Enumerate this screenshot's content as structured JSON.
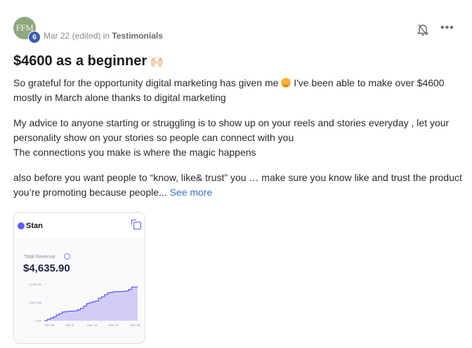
{
  "post": {
    "author_initials": "FFM",
    "level": "6",
    "date": "Mar 22 (edited)",
    "in_word": "in",
    "category": "Testimonials",
    "more_glyph": "•••",
    "title": "$4600 as a beginner",
    "title_emoji": "🙌🏻",
    "paragraphs": [
      {
        "before": "So grateful for the opportunity digital marketing has given me",
        "after": "I've been able to make over $4600 mostly in March alone thanks to digital marketing"
      },
      {
        "line1": "My advice to anyone starting or struggling is to show up on your reels and stories everyday , let your personality show on your stories so people can connect with you",
        "line2": "The connections you make is where the magic happens"
      },
      {
        "text": "also before you want people to “know, like& trust” you … make sure you know like and trust the product you’re promoting because people...",
        "see_more": "See more"
      }
    ]
  },
  "attachment": {
    "app_name": "Stan",
    "revenue_label": "Total Revenue",
    "revenue_value": "$4,635.90",
    "colors": {
      "accent": "#5b5ef0",
      "fill": "#c9c4f5"
    },
    "chart_data": {
      "type": "area",
      "y_tick_labels": [
        "5,000.00",
        "2,517.95",
        "0.00"
      ],
      "x_tick_labels": [
        "Feb 28",
        "Mar 8",
        "Mar 15",
        "Mar 22",
        "Mar 29"
      ],
      "ylim": [
        0,
        5035.9
      ],
      "x": [
        0,
        1,
        2,
        3,
        4,
        5,
        6,
        7,
        8,
        9,
        10,
        11,
        12,
        13,
        14,
        15,
        16,
        17,
        18,
        19,
        20,
        21,
        22,
        23,
        24,
        25,
        26,
        27,
        28,
        29,
        30,
        31
      ],
      "values": [
        0,
        180,
        350,
        520,
        800,
        1000,
        1200,
        1260,
        1300,
        1320,
        1350,
        1500,
        1700,
        2000,
        2350,
        2500,
        2600,
        2700,
        3100,
        3300,
        3600,
        3850,
        3900,
        4000,
        4010,
        4020,
        4050,
        4100,
        4300,
        4635.9,
        4635.9,
        4635.9
      ]
    }
  }
}
